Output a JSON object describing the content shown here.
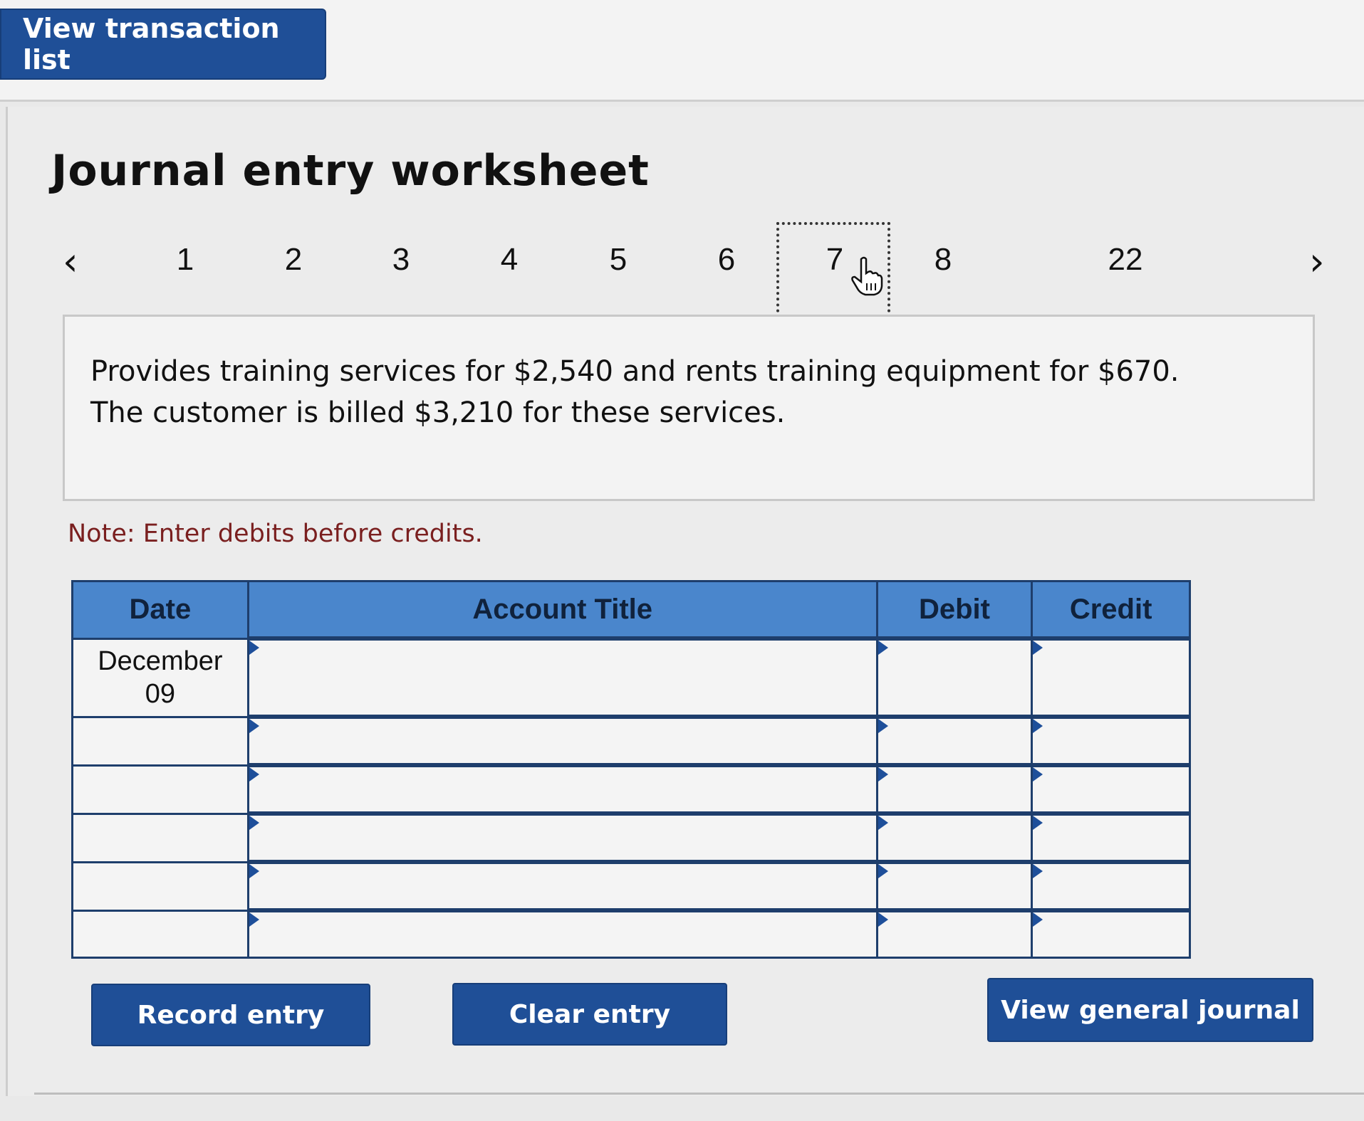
{
  "header": {
    "view_transaction_list": "View transaction list"
  },
  "worksheet": {
    "title": "Journal entry worksheet",
    "pager": {
      "prev_icon": "chevron-left-icon",
      "next_icon": "chevron-right-icon",
      "pages": [
        "1",
        "2",
        "3",
        "4",
        "5",
        "6",
        "7",
        "8",
        "22"
      ],
      "active_page": "7"
    },
    "description": {
      "line1": "Provides training services for $2,540 and rents training equipment for $670.",
      "line2": "The customer is billed $3,210 for these services."
    },
    "note": "Note: Enter debits before credits.",
    "table": {
      "headers": {
        "date": "Date",
        "account": "Account Title",
        "debit": "Debit",
        "credit": "Credit"
      },
      "rows": [
        {
          "date_line1": "December",
          "date_line2": "09",
          "account": "",
          "debit": "",
          "credit": ""
        },
        {
          "date_line1": "",
          "date_line2": "",
          "account": "",
          "debit": "",
          "credit": ""
        },
        {
          "date_line1": "",
          "date_line2": "",
          "account": "",
          "debit": "",
          "credit": ""
        },
        {
          "date_line1": "",
          "date_line2": "",
          "account": "",
          "debit": "",
          "credit": ""
        },
        {
          "date_line1": "",
          "date_line2": "",
          "account": "",
          "debit": "",
          "credit": ""
        },
        {
          "date_line1": "",
          "date_line2": "",
          "account": "",
          "debit": "",
          "credit": ""
        }
      ]
    },
    "buttons": {
      "record": "Record entry",
      "clear": "Clear entry",
      "view_general_journal": "View general journal"
    }
  },
  "colors": {
    "button_bg": "#1f4f97",
    "header_bg": "#4a86cc",
    "note_text": "#7a1f1f"
  }
}
